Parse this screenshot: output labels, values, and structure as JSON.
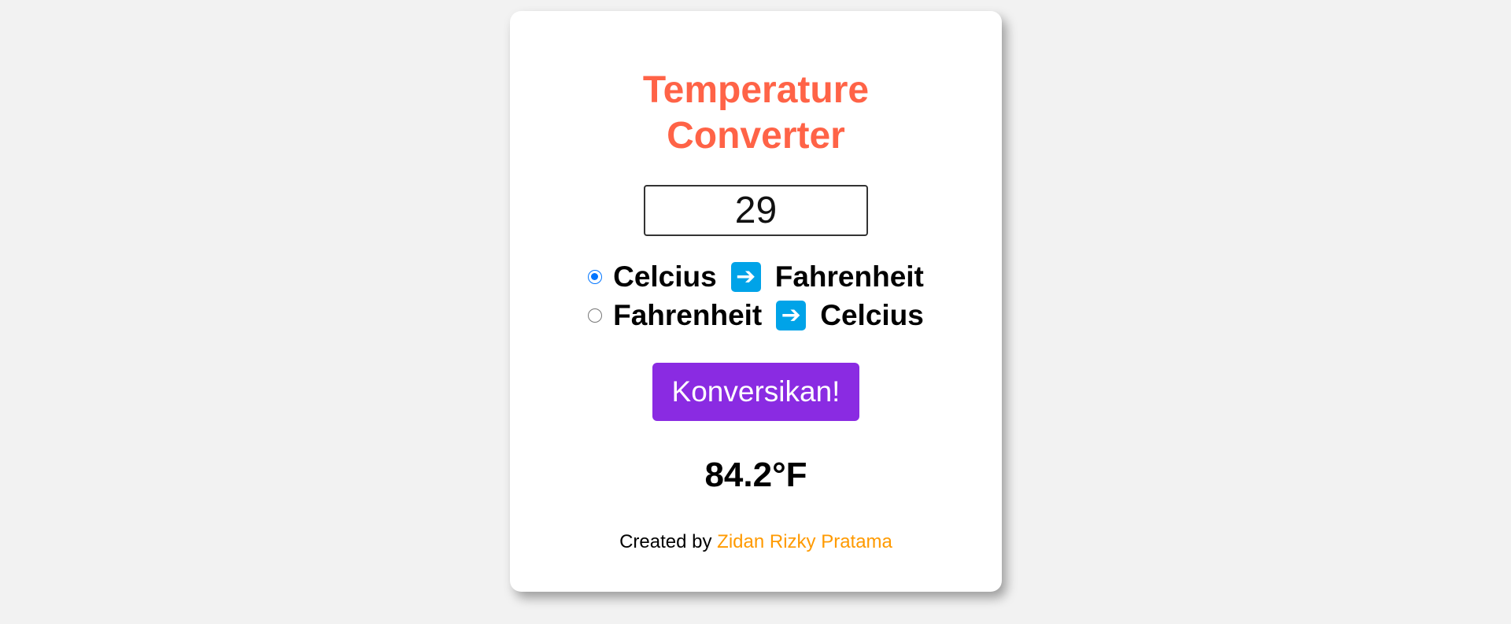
{
  "app": {
    "title_line1": "Temperature",
    "title_line2": "Converter"
  },
  "input": {
    "value": "29"
  },
  "options": [
    {
      "from": "Celcius",
      "to": "Fahrenheit",
      "checked": true,
      "arrow_icon": "right-arrow-icon"
    },
    {
      "from": "Fahrenheit",
      "to": "Celcius",
      "checked": false,
      "arrow_icon": "right-arrow-icon"
    }
  ],
  "convert_button": {
    "label": "Konversikan!"
  },
  "result": {
    "text": "84.2°F"
  },
  "footer": {
    "prefix": "Created by",
    "author": "Zidan Rizky Pratama"
  },
  "colors": {
    "background": "#f2f2f2",
    "title": "#ff6347",
    "button": "#8a2be2",
    "arrow": "#00a3e8",
    "radio_checked": "#0075ff",
    "author_link": "#ff9a00"
  }
}
